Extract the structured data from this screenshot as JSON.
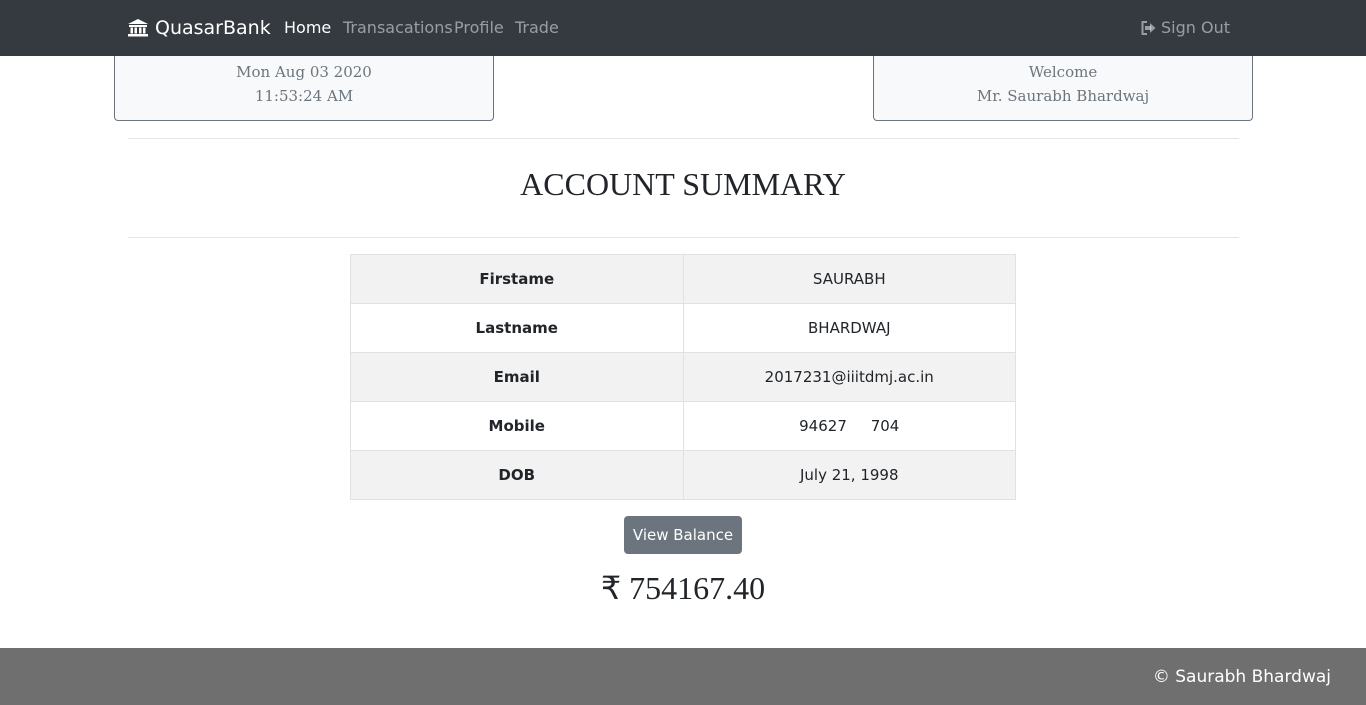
{
  "navbar": {
    "brand": "QuasarBank",
    "brand_icon": "bank-icon",
    "links": [
      {
        "label": "Home",
        "active": true
      },
      {
        "label": "Transacations",
        "active": false
      },
      {
        "label": "Profile",
        "active": false
      },
      {
        "label": "Trade",
        "active": false
      }
    ],
    "signout_label": "Sign Out",
    "signout_icon": "sign-out-icon"
  },
  "datetime": {
    "date": "Mon Aug 03 2020",
    "time": "11:53:24 AM"
  },
  "welcome": {
    "greeting": "Welcome",
    "name": "Mr. Saurabh Bhardwaj"
  },
  "summary": {
    "title": "ACCOUNT SUMMARY",
    "rows": [
      {
        "key": "Firstame",
        "value": "SAURABH"
      },
      {
        "key": "Lastname",
        "value": "BHARDWAJ"
      },
      {
        "key": "Email",
        "value": "2017231@iiitdmj.ac.in"
      },
      {
        "key": "Mobile",
        "value": "94627     704"
      },
      {
        "key": "DOB",
        "value": "July 21, 1998"
      }
    ]
  },
  "balance": {
    "button_label": "View Balance",
    "amount": "₹ 754167.40"
  },
  "footer": {
    "text": "© Saurabh Bhardwaj"
  },
  "colors": {
    "navbar_bg": "#343a40",
    "button_bg": "#6c757d",
    "footer_bg": "#6f6f6f",
    "card_bg": "#f8f9fa"
  }
}
